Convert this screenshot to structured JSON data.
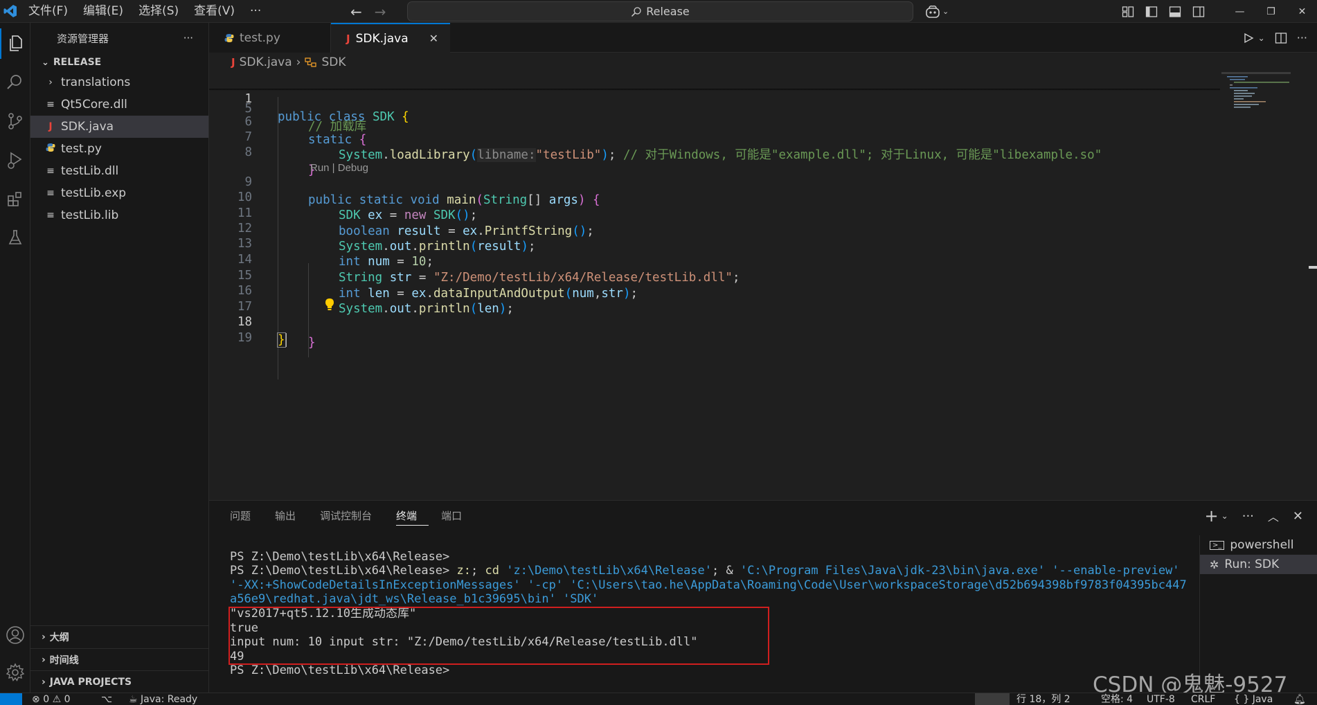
{
  "menu": [
    "文件(F)",
    "编辑(E)",
    "选择(S)",
    "查看(V)",
    "···"
  ],
  "command_center": "Release",
  "colors": {
    "accent": "#0078d4",
    "highlight_box": "#d01f1f"
  },
  "sidebar": {
    "title": "资源管理器",
    "more": "···",
    "folder": "RELEASE",
    "items": [
      {
        "label": "translations",
        "icon": "chevron-right-icon"
      },
      {
        "label": "Qt5Core.dll",
        "icon": "lines-icon"
      },
      {
        "label": "SDK.java",
        "icon": "java-icon"
      },
      {
        "label": "test.py",
        "icon": "python-icon"
      },
      {
        "label": "testLib.dll",
        "icon": "lines-icon"
      },
      {
        "label": "testLib.exp",
        "icon": "lines-icon"
      },
      {
        "label": "testLib.lib",
        "icon": "lines-icon"
      }
    ],
    "bottom_sections": [
      "大纲",
      "时间线",
      "JAVA PROJECTS"
    ]
  },
  "tabs": [
    {
      "label": "test.py",
      "icon": "python-icon"
    },
    {
      "label": "SDK.java",
      "icon": "java-icon"
    }
  ],
  "breadcrumb": {
    "file": "SDK.java",
    "symbol": "SDK"
  },
  "editor": {
    "line_numbers": [
      "1",
      "5",
      "6",
      "7",
      "8",
      "9",
      "10",
      "11",
      "12",
      "13",
      "14",
      "15",
      "16",
      "17",
      "18",
      "19"
    ],
    "codelens": "Run | Debug",
    "sticky": {
      "kw1": "public",
      "kw2": "class",
      "name": "SDK",
      "brace": "{"
    },
    "l5": {
      "comment": "// 加载库"
    },
    "l6": {
      "kw": "static",
      "brace": "{"
    },
    "l7": {
      "cls": "System",
      "dot": ".",
      "fn": "loadLibrary",
      "open": "(",
      "hint": "libname:",
      "str": "\"testLib\"",
      "close": ")",
      "semi": ";",
      "comment": " // 对于Windows, 可能是\"example.dll\"; 对于Linux, 可能是\"libexample.so\""
    },
    "l8": {
      "brace": "}"
    },
    "l9": {
      "kw1": "public",
      "kw2": "static",
      "kw3": "void",
      "fn": "main",
      "open": "(",
      "type": "String",
      "arr": "[]",
      "param": "args",
      "close": ")",
      "brace": "{"
    },
    "l10": {
      "type": "SDK",
      "var": "ex",
      "eq": " = ",
      "kw": "new",
      "ctor": "SDK",
      "parens": "()",
      "semi": ";"
    },
    "l11": {
      "kw": "boolean",
      "var": "result",
      "eq": " = ",
      "obj": "ex",
      "dot": ".",
      "fn": "PrintfString",
      "parens": "()",
      "semi": ";"
    },
    "l12": {
      "cls": "System",
      "dot": ".",
      "field": "out",
      "dot2": ".",
      "fn": "println",
      "open": "(",
      "arg": "result",
      "close": ")",
      "semi": ";"
    },
    "l13": {
      "kw": "int",
      "var": "num",
      "eq": " = ",
      "num": "10",
      "semi": ";"
    },
    "l14": {
      "type": "String",
      "var": "str",
      "eq": " = ",
      "str": "\"Z:/Demo/testLib/x64/Release/testLib.dll\"",
      "semi": ";"
    },
    "l15": {
      "kw": "int",
      "var": "len",
      "eq": " = ",
      "obj": "ex",
      "dot": ".",
      "fn": "dataInputAndOutput",
      "open": "(",
      "a1": "num",
      "comma": ",",
      "a2": "str",
      "close": ")",
      "semi": ";"
    },
    "l16": {
      "cls": "System",
      "dot": ".",
      "field": "out",
      "dot2": ".",
      "fn": "println",
      "open": "(",
      "arg": "len",
      "close": ")",
      "semi": ";"
    },
    "l17": {
      "brace": "}"
    },
    "l18": {
      "brace": "}"
    }
  },
  "panel": {
    "tabs": [
      "问题",
      "输出",
      "调试控制台",
      "终端",
      "端口"
    ],
    "terminal": {
      "prompt1": "PS Z:\\Demo\\testLib\\x64\\Release>",
      "prompt2": "PS Z:\\Demo\\testLib\\x64\\Release> ",
      "cmd1": "z:",
      "sep1": "; ",
      "cmd2": "cd",
      "path": " 'z:\\Demo\\testLib\\x64\\Release'",
      "amp": "; & ",
      "java": "'C:\\Program Files\\Java\\jdk-23\\bin\\java.exe' '--enable-preview' '-XX:+ShowCodeDetailsInExceptionMessages' '-cp' 'C:\\Users\\tao.he\\AppData\\Roaming\\Code\\User\\workspaceStorage\\d52b694398bf9783f04395bc447a56e9\\redhat.java\\jdt_ws\\Release_b1c39695\\bin' 'SDK'",
      "out1": "\"vs2017+qt5.12.10生成动态库\"",
      "out2": "true",
      "out3": "input num: 10 input str: \"Z:/Demo/testLib/x64/Release/testLib.dll\"",
      "out4": "49",
      "prompt3": "PS Z:\\Demo\\testLib\\x64\\Release>"
    },
    "terminal_list": [
      "powershell",
      "Run: SDK"
    ]
  },
  "statusbar": {
    "errors": "0",
    "warnings": "0",
    "java_status": "Java: Ready",
    "position": "行 18，列 2",
    "spaces": "空格: 4",
    "encoding": "UTF-8",
    "eol": "CRLF",
    "language": "{ } Java"
  },
  "watermark": "CSDN @鬼魅-9527"
}
